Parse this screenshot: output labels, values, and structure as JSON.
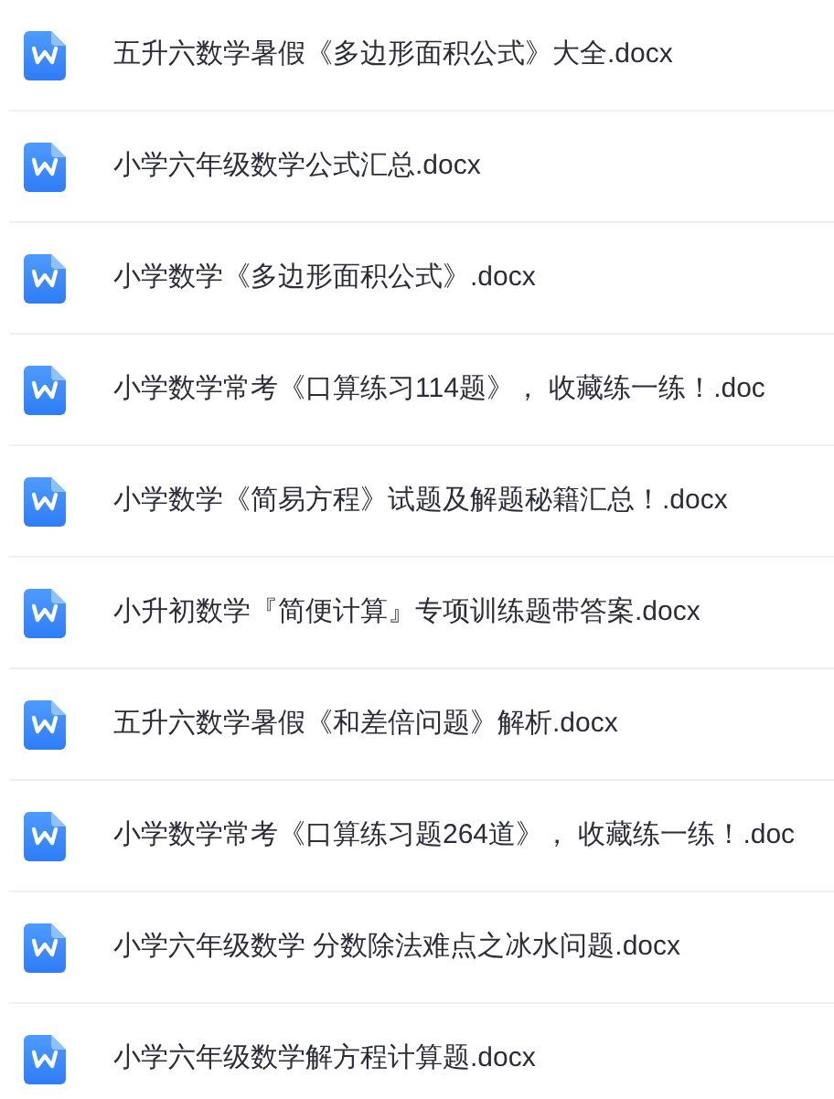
{
  "files": [
    {
      "name": "五升六数学暑假《多边形面积公式》大全.docx"
    },
    {
      "name": "小学六年级数学公式汇总.docx"
    },
    {
      "name": "小学数学《多边形面积公式》.docx"
    },
    {
      "name": "小学数学常考《口算练习114题》， 收藏练一练！.doc"
    },
    {
      "name": "小学数学《简易方程》试题及解题秘籍汇总！.docx"
    },
    {
      "name": "小升初数学『简便计算』专项训练题带答案.docx"
    },
    {
      "name": "五升六数学暑假《和差倍问题》解析.docx"
    },
    {
      "name": "小学数学常考《口算练习题264道》， 收藏练一练！.doc"
    },
    {
      "name": "小学六年级数学 分数除法难点之冰水问题.docx"
    },
    {
      "name": "小学六年级数学解方程计算题.docx"
    }
  ]
}
